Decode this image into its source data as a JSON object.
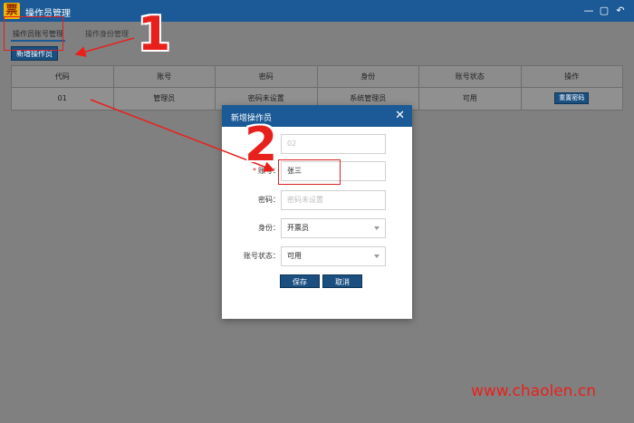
{
  "window": {
    "logo_glyph": "票",
    "title": "操作员管理",
    "minimize": "—",
    "maximize": "▢",
    "restore": "↶"
  },
  "tabs": [
    {
      "label": "操作员账号管理"
    },
    {
      "label": "操作身份管理"
    }
  ],
  "toolbar": {
    "add_label": "新增操作员"
  },
  "table": {
    "headers": [
      "代码",
      "账号",
      "密码",
      "身份",
      "账号状态",
      "操作"
    ],
    "rows": [
      {
        "code": "01",
        "account": "管理员",
        "password": "密码未设置",
        "role": "系统管理员",
        "status": "可用",
        "action": "重置密码"
      }
    ]
  },
  "dialog": {
    "title": "新增操作员",
    "close_glyph": "✕",
    "fields": {
      "code": {
        "value": "02"
      },
      "account": {
        "label": "账号：",
        "value": "张三"
      },
      "password": {
        "label": "密码：",
        "placeholder": "密码未设置"
      },
      "role": {
        "label": "身份：",
        "value": "开票员"
      },
      "status": {
        "label": "账号状态：",
        "value": "可用"
      }
    },
    "save_label": "保存",
    "cancel_label": "取消"
  },
  "annotations": {
    "step1": "1",
    "step2": "2"
  },
  "watermark": "www.chaolen.cn",
  "colors": {
    "header": "#1b5a96",
    "button": "#1b4f80",
    "annotation": "#e8201c"
  }
}
